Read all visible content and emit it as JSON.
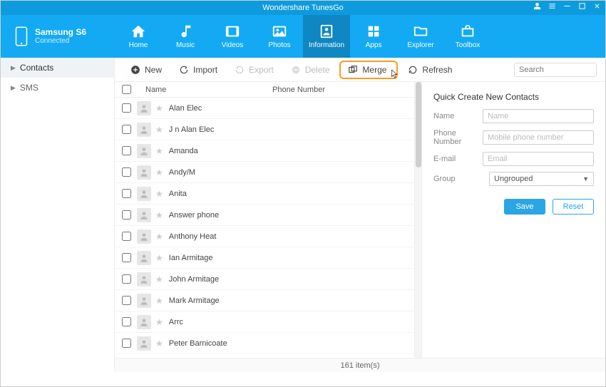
{
  "app_title": "Wondershare TunesGo",
  "device": {
    "name": "Samsung S6",
    "status": "Connected"
  },
  "nav": [
    {
      "label": "Home"
    },
    {
      "label": "Music"
    },
    {
      "label": "Videos"
    },
    {
      "label": "Photos"
    },
    {
      "label": "Information",
      "active": true
    },
    {
      "label": "Apps"
    },
    {
      "label": "Explorer"
    },
    {
      "label": "Toolbox"
    }
  ],
  "sidebar": {
    "items": [
      {
        "label": "Contacts",
        "active": true
      },
      {
        "label": "SMS"
      }
    ]
  },
  "toolbar": {
    "new_label": "New",
    "import_label": "Import",
    "export_label": "Export",
    "delete_label": "Delete",
    "merge_label": "Merge",
    "refresh_label": "Refresh",
    "search_placeholder": "Search"
  },
  "table": {
    "headers": {
      "name": "Name",
      "phone": "Phone Number"
    },
    "rows": [
      {
        "name": "Alan Elec"
      },
      {
        "name": "J n  Alan Elec"
      },
      {
        "name": "Amanda"
      },
      {
        "name": "Andy/M"
      },
      {
        "name": "Anita"
      },
      {
        "name": "Answer phone"
      },
      {
        "name": "Anthony Heat"
      },
      {
        "name": "Ian  Armitage"
      },
      {
        "name": "John  Armitage"
      },
      {
        "name": "Mark  Armitage"
      },
      {
        "name": "Arrc"
      },
      {
        "name": "Peter  Barnicoate"
      }
    ]
  },
  "right_panel": {
    "title": "Quick Create New Contacts",
    "labels": {
      "name": "Name",
      "phone": "Phone Number",
      "email": "E-mail",
      "group": "Group"
    },
    "placeholders": {
      "name": "Name",
      "phone": "Mobile phone number",
      "email": "Email"
    },
    "group_value": "Ungrouped",
    "save": "Save",
    "reset": "Reset"
  },
  "status": "161 item(s)"
}
